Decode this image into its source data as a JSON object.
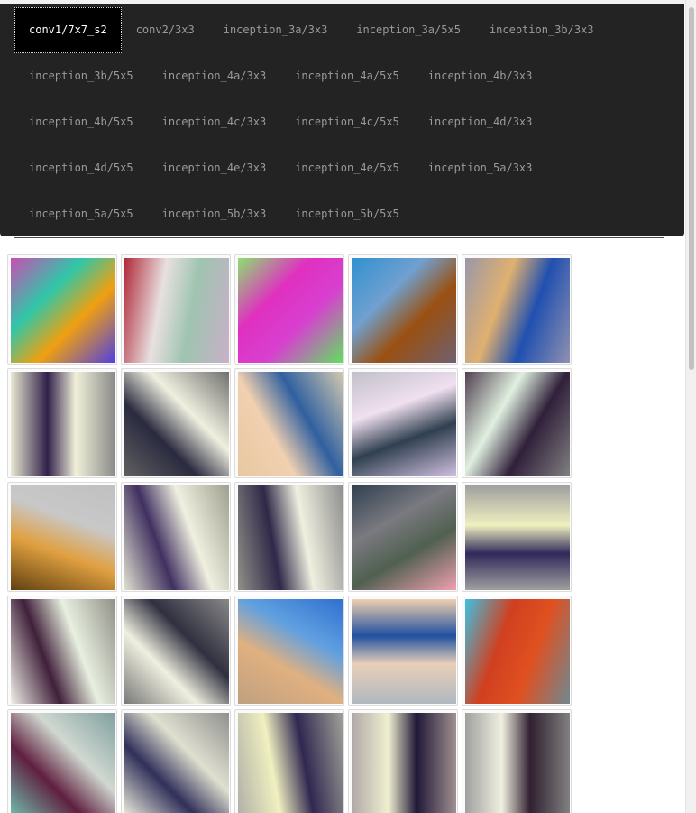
{
  "tabs": [
    {
      "label": "conv1/7x7_s2",
      "active": true
    },
    {
      "label": "conv2/3x3",
      "active": false
    },
    {
      "label": "inception_3a/3x3",
      "active": false
    },
    {
      "label": "inception_3a/5x5",
      "active": false
    },
    {
      "label": "inception_3b/3x3",
      "active": false
    },
    {
      "label": "inception_3b/5x5",
      "active": false
    },
    {
      "label": "inception_4a/3x3",
      "active": false
    },
    {
      "label": "inception_4a/5x5",
      "active": false
    },
    {
      "label": "inception_4b/3x3",
      "active": false
    },
    {
      "label": "inception_4b/5x5",
      "active": false
    },
    {
      "label": "inception_4c/3x3",
      "active": false
    },
    {
      "label": "inception_4c/5x5",
      "active": false
    },
    {
      "label": "inception_4d/3x3",
      "active": false
    },
    {
      "label": "inception_4d/5x5",
      "active": false
    },
    {
      "label": "inception_4e/3x3",
      "active": false
    },
    {
      "label": "inception_4e/5x5",
      "active": false
    },
    {
      "label": "inception_5a/3x3",
      "active": false
    },
    {
      "label": "inception_5a/5x5",
      "active": false
    },
    {
      "label": "inception_5b/3x3",
      "active": false
    },
    {
      "label": "inception_5b/5x5",
      "active": false
    }
  ],
  "filters": [
    {
      "bg": "#7a8a8a",
      "stops": [
        "#c84fb4",
        "#2fc7a8",
        "#f0a010",
        "#5040e0"
      ],
      "angle": 135
    },
    {
      "bg": "#a9b5b5",
      "stops": [
        "#b02838",
        "#e8e0e0",
        "#9fc4b0",
        "#c8b0c8"
      ],
      "angle": 100
    },
    {
      "bg": "#909090",
      "stops": [
        "#8ce070",
        "#e030c0",
        "#d840d0",
        "#60e060"
      ],
      "angle": 135
    },
    {
      "bg": "#7a7a80",
      "stops": [
        "#3090d0",
        "#70a0d0",
        "#9a5010",
        "#706070"
      ],
      "angle": 135
    },
    {
      "bg": "#8a8c98",
      "stops": [
        "#9a98a8",
        "#e0b070",
        "#2050b0",
        "#9090b0"
      ],
      "angle": 110
    },
    {
      "bg": "#9a9c98",
      "stops": [
        "#e8e8d0",
        "#30204a",
        "#f0f0d8",
        "#8a8a8a"
      ],
      "angle": 90
    },
    {
      "bg": "#8c8c8c",
      "stops": [
        "#606060",
        "#2a2a40",
        "#f0f0e0",
        "#707070"
      ],
      "angle": 45
    },
    {
      "bg": "#a8a8a4",
      "stops": [
        "#e8c8a0",
        "#f0d0b0",
        "#3060a0",
        "#d0c8b0"
      ],
      "angle": 60
    },
    {
      "bg": "#b0b0b0",
      "stops": [
        "#c0c0c8",
        "#f0e0f0",
        "#304050",
        "#d0c0e0"
      ],
      "angle": 160
    },
    {
      "bg": "#707070",
      "stops": [
        "#504050",
        "#e0f0e0",
        "#30203a",
        "#808080"
      ],
      "angle": 120
    },
    {
      "bg": "#b0b4b8",
      "stops": [
        "#c0c0c0",
        "#c8c8c8",
        "#e0a040",
        "#604010"
      ],
      "angle": 200
    },
    {
      "bg": "#b0b0a8",
      "stops": [
        "#e0e0d0",
        "#403060",
        "#f0f0e0",
        "#a0a090"
      ],
      "angle": 70
    },
    {
      "bg": "#8c8c88",
      "stops": [
        "#909088",
        "#302848",
        "#f0f0e0",
        "#909090"
      ],
      "angle": 80
    },
    {
      "bg": "#4a5058",
      "stops": [
        "#304050",
        "#7a7a80",
        "#506050",
        "#f0a0b0"
      ],
      "angle": 150
    },
    {
      "bg": "#989898",
      "stops": [
        "#a0a0a0",
        "#30285a",
        "#f0f0c0",
        "#a0a0a0"
      ],
      "angle": 0
    },
    {
      "bg": "#b0b0a8",
      "stops": [
        "#f0f0e8",
        "#40203a",
        "#e8f0e0",
        "#909088"
      ],
      "angle": 70
    },
    {
      "bg": "#888888",
      "stops": [
        "#787878",
        "#f0f0e0",
        "#303040",
        "#888888"
      ],
      "angle": 45
    },
    {
      "bg": "#c8a888",
      "stops": [
        "#3070d0",
        "#60a0e0",
        "#e0b080",
        "#c0a080"
      ],
      "angle": 210
    },
    {
      "bg": "#d0c8c0",
      "stops": [
        "#f0d0b0",
        "#2050a0",
        "#e8d0b8",
        "#b0b8c0"
      ],
      "angle": 180
    },
    {
      "bg": "#708890",
      "stops": [
        "#40c0e0",
        "#d04020",
        "#e05020",
        "#708890"
      ],
      "angle": 110
    },
    {
      "bg": "#9aa0a0",
      "stops": [
        "#70c0b0",
        "#602040",
        "#d0d8d0",
        "#80a0a0"
      ],
      "angle": 45
    },
    {
      "bg": "#a0a0a0",
      "stops": [
        "#f0f0e0",
        "#30305a",
        "#e0e0d0",
        "#909090"
      ],
      "angle": 45
    },
    {
      "bg": "#a8a8a0",
      "stops": [
        "#b0b0a8",
        "#f0f0c0",
        "#302850",
        "#a0a098"
      ],
      "angle": 80
    },
    {
      "bg": "#b8b0b0",
      "stops": [
        "#b0a8a8",
        "#f0f0d0",
        "#201838",
        "#a09090"
      ],
      "angle": 90
    },
    {
      "bg": "#a0a098",
      "stops": [
        "#a0a0a0",
        "#f0f0e0",
        "#302030",
        "#808080"
      ],
      "angle": 90
    }
  ]
}
